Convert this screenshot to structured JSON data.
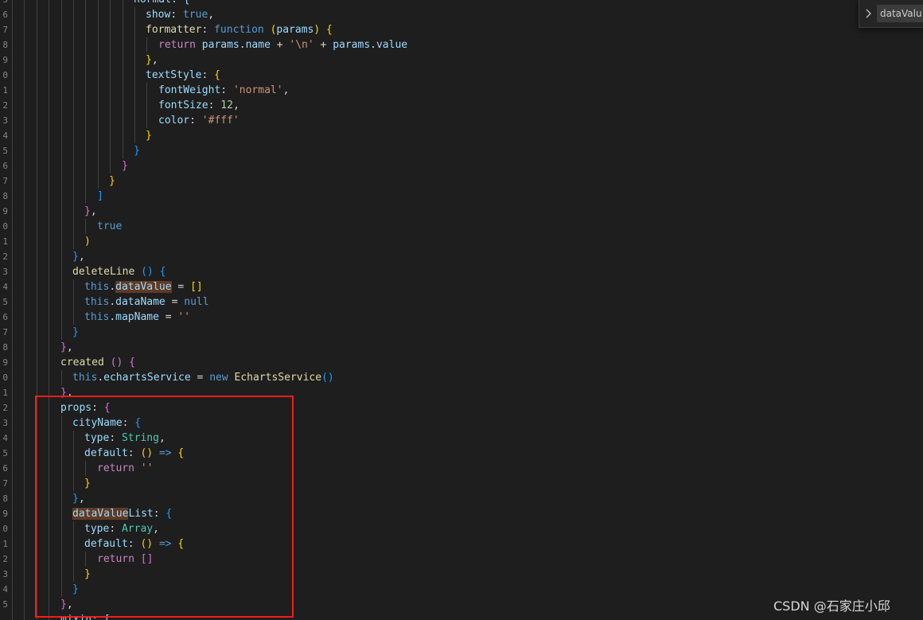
{
  "gutter_numbers": [
    "5",
    "6",
    "7",
    "8",
    "9",
    "0",
    "1",
    "2",
    "3",
    "4",
    "5",
    "6",
    "7",
    "8",
    "9",
    "0",
    "1",
    "2",
    "3",
    "4",
    "5",
    "6",
    "7",
    "8",
    "9",
    "0",
    "1",
    "2",
    "3",
    "4",
    "5",
    "6",
    "7",
    "8",
    "9",
    "0",
    "1",
    "2",
    "3",
    "4",
    "5"
  ],
  "code_lines": [
    {
      "depth": 10,
      "tokens": [
        {
          "t": "normal: {",
          "c": "prop"
        }
      ]
    },
    {
      "depth": 11,
      "tokens": [
        {
          "t": "show",
          "c": "prop"
        },
        {
          "t": ": ",
          "c": "plain"
        },
        {
          "t": "true",
          "c": "kw"
        },
        {
          "t": ",",
          "c": "plain"
        }
      ]
    },
    {
      "depth": 11,
      "tokens": [
        {
          "t": "formatter",
          "c": "func"
        },
        {
          "t": ": ",
          "c": "plain"
        },
        {
          "t": "function",
          "c": "kw"
        },
        {
          "t": " ",
          "c": "plain"
        },
        {
          "t": "(",
          "c": "b1"
        },
        {
          "t": "params",
          "c": "prop"
        },
        {
          "t": ")",
          "c": "b1"
        },
        {
          "t": " ",
          "c": "plain"
        },
        {
          "t": "{",
          "c": "b1"
        }
      ]
    },
    {
      "depth": 12,
      "tokens": [
        {
          "t": "return",
          "c": "ctl"
        },
        {
          "t": " ",
          "c": "plain"
        },
        {
          "t": "params",
          "c": "prop"
        },
        {
          "t": ".",
          "c": "plain"
        },
        {
          "t": "name",
          "c": "prop"
        },
        {
          "t": " + ",
          "c": "plain"
        },
        {
          "t": "'\\n'",
          "c": "str"
        },
        {
          "t": " + ",
          "c": "plain"
        },
        {
          "t": "params",
          "c": "prop"
        },
        {
          "t": ".",
          "c": "plain"
        },
        {
          "t": "value",
          "c": "prop"
        }
      ]
    },
    {
      "depth": 11,
      "tokens": [
        {
          "t": "}",
          "c": "b1"
        },
        {
          "t": ",",
          "c": "plain"
        }
      ]
    },
    {
      "depth": 11,
      "tokens": [
        {
          "t": "textStyle",
          "c": "prop"
        },
        {
          "t": ": ",
          "c": "plain"
        },
        {
          "t": "{",
          "c": "b1"
        }
      ]
    },
    {
      "depth": 12,
      "tokens": [
        {
          "t": "fontWeight",
          "c": "prop"
        },
        {
          "t": ": ",
          "c": "plain"
        },
        {
          "t": "'normal'",
          "c": "str"
        },
        {
          "t": ",",
          "c": "plain"
        }
      ]
    },
    {
      "depth": 12,
      "tokens": [
        {
          "t": "fontSize",
          "c": "prop"
        },
        {
          "t": ": ",
          "c": "plain"
        },
        {
          "t": "12",
          "c": "num"
        },
        {
          "t": ",",
          "c": "plain"
        }
      ]
    },
    {
      "depth": 12,
      "tokens": [
        {
          "t": "color",
          "c": "prop"
        },
        {
          "t": ": ",
          "c": "plain"
        },
        {
          "t": "'#fff'",
          "c": "str"
        }
      ]
    },
    {
      "depth": 11,
      "tokens": [
        {
          "t": "}",
          "c": "b1"
        }
      ]
    },
    {
      "depth": 10,
      "tokens": [
        {
          "t": "}",
          "c": "b3"
        }
      ]
    },
    {
      "depth": 9,
      "tokens": [
        {
          "t": "}",
          "c": "b2"
        }
      ]
    },
    {
      "depth": 8,
      "tokens": [
        {
          "t": "}",
          "c": "b1"
        }
      ]
    },
    {
      "depth": 7,
      "tokens": [
        {
          "t": "]",
          "c": "b3"
        }
      ]
    },
    {
      "depth": 6,
      "tokens": [
        {
          "t": "}",
          "c": "b2"
        },
        {
          "t": ",",
          "c": "plain"
        }
      ]
    },
    {
      "depth": 7,
      "tokens": [
        {
          "t": "true",
          "c": "kw"
        }
      ]
    },
    {
      "depth": 6,
      "tokens": [
        {
          "t": ")",
          "c": "b1"
        }
      ]
    },
    {
      "depth": 5,
      "tokens": [
        {
          "t": "}",
          "c": "b3"
        },
        {
          "t": ",",
          "c": "plain"
        }
      ]
    },
    {
      "depth": 5,
      "tokens": [
        {
          "t": "deleteLine",
          "c": "func"
        },
        {
          "t": " ",
          "c": "plain"
        },
        {
          "t": "()",
          "c": "b3"
        },
        {
          "t": " ",
          "c": "plain"
        },
        {
          "t": "{",
          "c": "b3"
        }
      ]
    },
    {
      "depth": 6,
      "tokens": [
        {
          "t": "this",
          "c": "kw"
        },
        {
          "t": ".",
          "c": "plain"
        },
        {
          "t": "dataValue",
          "c": "prop",
          "hl": true
        },
        {
          "t": " = ",
          "c": "plain"
        },
        {
          "t": "[]",
          "c": "b1"
        }
      ]
    },
    {
      "depth": 6,
      "tokens": [
        {
          "t": "this",
          "c": "kw"
        },
        {
          "t": ".",
          "c": "plain"
        },
        {
          "t": "dataName",
          "c": "prop"
        },
        {
          "t": " = ",
          "c": "plain"
        },
        {
          "t": "null",
          "c": "kw"
        }
      ]
    },
    {
      "depth": 6,
      "tokens": [
        {
          "t": "this",
          "c": "kw"
        },
        {
          "t": ".",
          "c": "plain"
        },
        {
          "t": "mapName",
          "c": "prop"
        },
        {
          "t": " = ",
          "c": "plain"
        },
        {
          "t": "''",
          "c": "str"
        }
      ]
    },
    {
      "depth": 5,
      "tokens": [
        {
          "t": "}",
          "c": "b3"
        }
      ]
    },
    {
      "depth": 4,
      "tokens": [
        {
          "t": "}",
          "c": "b2"
        },
        {
          "t": ",",
          "c": "plain"
        }
      ]
    },
    {
      "depth": 4,
      "tokens": [
        {
          "t": "created",
          "c": "func"
        },
        {
          "t": " ",
          "c": "plain"
        },
        {
          "t": "()",
          "c": "b2"
        },
        {
          "t": " ",
          "c": "plain"
        },
        {
          "t": "{",
          "c": "b2"
        }
      ]
    },
    {
      "depth": 5,
      "tokens": [
        {
          "t": "this",
          "c": "kw"
        },
        {
          "t": ".",
          "c": "plain"
        },
        {
          "t": "echartsService",
          "c": "prop"
        },
        {
          "t": " = ",
          "c": "plain"
        },
        {
          "t": "new",
          "c": "kw"
        },
        {
          "t": " ",
          "c": "plain"
        },
        {
          "t": "EchartsService",
          "c": "func"
        },
        {
          "t": "()",
          "c": "b3"
        }
      ]
    },
    {
      "depth": 4,
      "tokens": [
        {
          "t": "}",
          "c": "b2"
        },
        {
          "t": ",",
          "c": "plain"
        }
      ]
    },
    {
      "depth": 4,
      "tokens": [
        {
          "t": "props",
          "c": "prop"
        },
        {
          "t": ": ",
          "c": "plain"
        },
        {
          "t": "{",
          "c": "b2"
        }
      ]
    },
    {
      "depth": 5,
      "tokens": [
        {
          "t": "cityName",
          "c": "prop"
        },
        {
          "t": ": ",
          "c": "plain"
        },
        {
          "t": "{",
          "c": "b3"
        }
      ]
    },
    {
      "depth": 6,
      "tokens": [
        {
          "t": "type",
          "c": "prop"
        },
        {
          "t": ": ",
          "c": "plain"
        },
        {
          "t": "String",
          "c": "type"
        },
        {
          "t": ",",
          "c": "plain"
        }
      ]
    },
    {
      "depth": 6,
      "tokens": [
        {
          "t": "default",
          "c": "prop"
        },
        {
          "t": ": ",
          "c": "plain"
        },
        {
          "t": "()",
          "c": "b1"
        },
        {
          "t": " ",
          "c": "plain"
        },
        {
          "t": "=>",
          "c": "kw"
        },
        {
          "t": " ",
          "c": "plain"
        },
        {
          "t": "{",
          "c": "b1"
        }
      ]
    },
    {
      "depth": 7,
      "tokens": [
        {
          "t": "return",
          "c": "ctl"
        },
        {
          "t": " ",
          "c": "plain"
        },
        {
          "t": "''",
          "c": "str"
        }
      ]
    },
    {
      "depth": 6,
      "tokens": [
        {
          "t": "}",
          "c": "b1"
        }
      ]
    },
    {
      "depth": 5,
      "tokens": [
        {
          "t": "}",
          "c": "b3"
        },
        {
          "t": ",",
          "c": "plain"
        }
      ]
    },
    {
      "depth": 5,
      "tokens": [
        {
          "t": "dataValue",
          "c": "prop",
          "hl": true
        },
        {
          "t": "List",
          "c": "prop"
        },
        {
          "t": ": ",
          "c": "plain"
        },
        {
          "t": "{",
          "c": "b3"
        }
      ]
    },
    {
      "depth": 6,
      "tokens": [
        {
          "t": "type",
          "c": "prop"
        },
        {
          "t": ": ",
          "c": "plain"
        },
        {
          "t": "Array",
          "c": "type"
        },
        {
          "t": ",",
          "c": "plain"
        }
      ]
    },
    {
      "depth": 6,
      "tokens": [
        {
          "t": "default",
          "c": "prop"
        },
        {
          "t": ": ",
          "c": "plain"
        },
        {
          "t": "()",
          "c": "b1"
        },
        {
          "t": " ",
          "c": "plain"
        },
        {
          "t": "=>",
          "c": "kw"
        },
        {
          "t": " ",
          "c": "plain"
        },
        {
          "t": "{",
          "c": "b1"
        }
      ]
    },
    {
      "depth": 7,
      "tokens": [
        {
          "t": "return",
          "c": "ctl"
        },
        {
          "t": " ",
          "c": "plain"
        },
        {
          "t": "[]",
          "c": "b2"
        }
      ]
    },
    {
      "depth": 6,
      "tokens": [
        {
          "t": "}",
          "c": "b1"
        }
      ]
    },
    {
      "depth": 5,
      "tokens": [
        {
          "t": "}",
          "c": "b3"
        }
      ]
    },
    {
      "depth": 4,
      "tokens": [
        {
          "t": "}",
          "c": "b2"
        },
        {
          "t": ",",
          "c": "plain"
        }
      ]
    },
    {
      "depth": 4,
      "tokens": [
        {
          "t": "mixin: [",
          "c": "prop"
        }
      ]
    }
  ],
  "find_widget": {
    "toggle_icon": "chevron-right-icon",
    "query": "dataValue"
  },
  "watermark": "CSDN @石家庄小邱",
  "colors": {
    "background": "#1e1e1e",
    "selection_outline": "#ff1a1a",
    "match_highlight": "#613a25"
  }
}
